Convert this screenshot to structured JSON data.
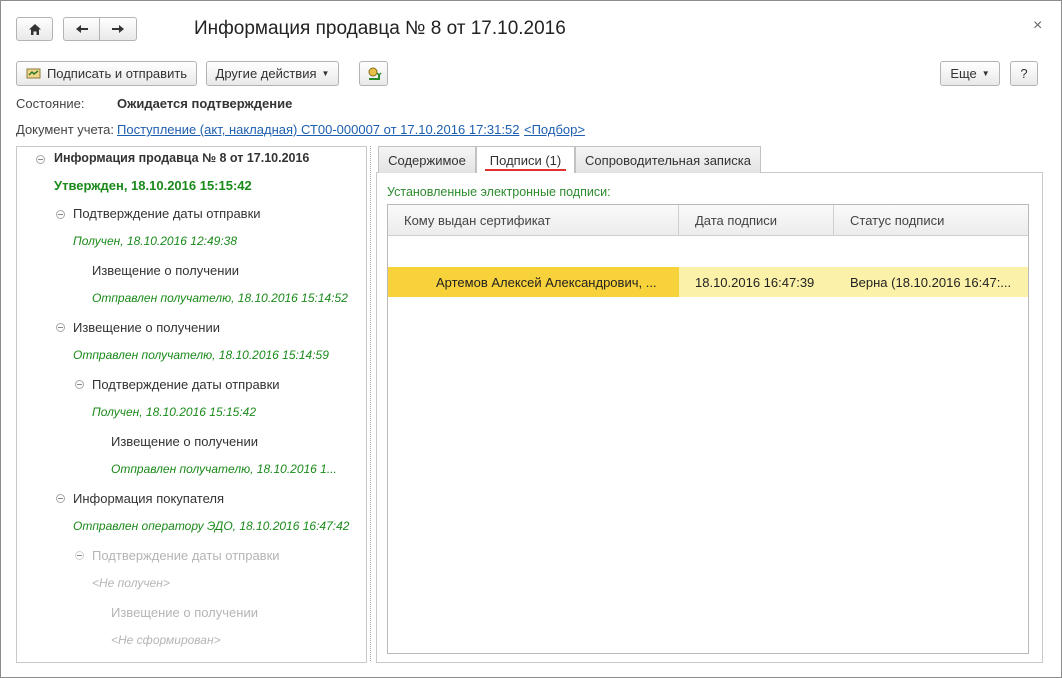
{
  "window": {
    "title": "Информация продавца № 8 от 17.10.2016",
    "close_glyph": "×"
  },
  "nav": {
    "home_icon": "home-icon",
    "back_icon": "arrow-left-icon",
    "forward_icon": "arrow-right-icon"
  },
  "toolbar": {
    "sign_send_label": "Подписать и отправить",
    "other_actions_label": "Другие действия",
    "more_label": "Еще",
    "help_label": "?"
  },
  "status": {
    "label": "Состояние:",
    "value": "Ожидается подтверждение"
  },
  "document": {
    "label": "Документ учета:",
    "link": "Поступление (акт, накладная) СТ00-000007 от 17.10.2016 17:31:52",
    "pick_link": "<Подбор>"
  },
  "tree": [
    {
      "text": "Информация продавца № 8 от 17.10.2016",
      "style": "bold"
    },
    {
      "text": "Утвержден, 18.10.2016 15:15:42",
      "style": "greenbold"
    },
    {
      "text": "Подтверждение даты отправки",
      "style": "normal"
    },
    {
      "text": "Получен, 18.10.2016 12:49:38",
      "style": "green"
    },
    {
      "text": "Извещение о получении",
      "style": "normal"
    },
    {
      "text": "Отправлен получателю, 18.10.2016 15:14:52",
      "style": "green"
    },
    {
      "text": "Извещение о получении",
      "style": "normal"
    },
    {
      "text": "Отправлен получателю, 18.10.2016 15:14:59",
      "style": "green"
    },
    {
      "text": "Подтверждение даты отправки",
      "style": "normal"
    },
    {
      "text": "Получен, 18.10.2016 15:15:42",
      "style": "green"
    },
    {
      "text": "Извещение о получении",
      "style": "normal"
    },
    {
      "text": "Отправлен получателю, 18.10.2016 1...",
      "style": "green"
    },
    {
      "text": "Информация покупателя",
      "style": "normal"
    },
    {
      "text": "Отправлен оператору ЭДО, 18.10.2016 16:47:42",
      "style": "green"
    },
    {
      "text": "Подтверждение даты отправки",
      "style": "gray"
    },
    {
      "text": "<Не получен>",
      "style": "grayit"
    },
    {
      "text": "Извещение о получении",
      "style": "gray"
    },
    {
      "text": "<Не сформирован>",
      "style": "grayit"
    }
  ],
  "tabs": [
    {
      "label": "Содержимое"
    },
    {
      "label": "Подписи (1)"
    },
    {
      "label": "Сопроводительная записка"
    }
  ],
  "signatures": {
    "caption": "Установленные электронные подписи:",
    "columns": [
      "Кому выдан сертификат",
      "Дата подписи",
      "Статус подписи"
    ],
    "rows": [
      {
        "owner": "Артемов Алексей Александрович, ...",
        "date": "18.10.2016 16:47:39",
        "status": "Верна (18.10.2016 16:47:..."
      }
    ]
  },
  "colors": {
    "accent_green": "#1a8a1a",
    "link_blue": "#1d5fb0",
    "selection_yellow": "#f8d23a",
    "tab_underline": "#e03030"
  }
}
